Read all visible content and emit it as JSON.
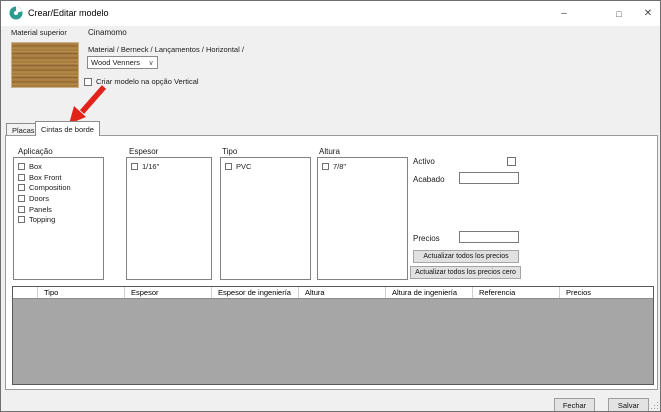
{
  "window": {
    "title": "Crear/Editar modelo",
    "minimize_glyph": "–",
    "maximize_glyph": "□",
    "close_glyph": "✕"
  },
  "header": {
    "material_label": "Material superior",
    "material_name": "Cinamomo",
    "breadcrumb": "Material / Berneck / Lançamentos / Horizontal /",
    "finish_dropdown": {
      "value": "Wood Venners",
      "chevron": "∨"
    },
    "vertical_checkbox_label": "Criar modelo na opção  Vertical"
  },
  "tabs": {
    "placas": "Placas",
    "cintas": "Cintas de borde"
  },
  "filters": {
    "application": {
      "label": "Aplicação",
      "items": [
        "Box",
        "Box Front",
        "Composition",
        "Doors",
        "Panels",
        "Topping"
      ]
    },
    "thickness": {
      "label": "Espesor",
      "items": [
        "1/16\""
      ]
    },
    "type": {
      "label": "Tipo",
      "items": [
        "PVC"
      ]
    },
    "height": {
      "label": "Altura",
      "items": [
        "7/8\""
      ]
    }
  },
  "right_panel": {
    "active_label": "Activo",
    "finish_label": "Acabado",
    "finish_value": "",
    "prices_label": "Precios",
    "prices_value": "",
    "update_all_prices_label": "Actualizar todos los precios",
    "update_all_prices_zero_label": "Actualizar todos los precios cero"
  },
  "table": {
    "columns": [
      "Tipo",
      "Espesor",
      "Espesor de ingeniería",
      "Altura",
      "Altura de ingeniería",
      "Referencia",
      "Precios"
    ],
    "rows": []
  },
  "footer": {
    "close_label": "Fechar",
    "save_label": "Salvar"
  },
  "colors": {
    "accent_teal": "#2a9d8f",
    "arrow_red": "#e2231a",
    "table_body_gray": "#a6a6a6",
    "wood_base": "#a87b3f",
    "window_bg": "#f0f0f0"
  }
}
